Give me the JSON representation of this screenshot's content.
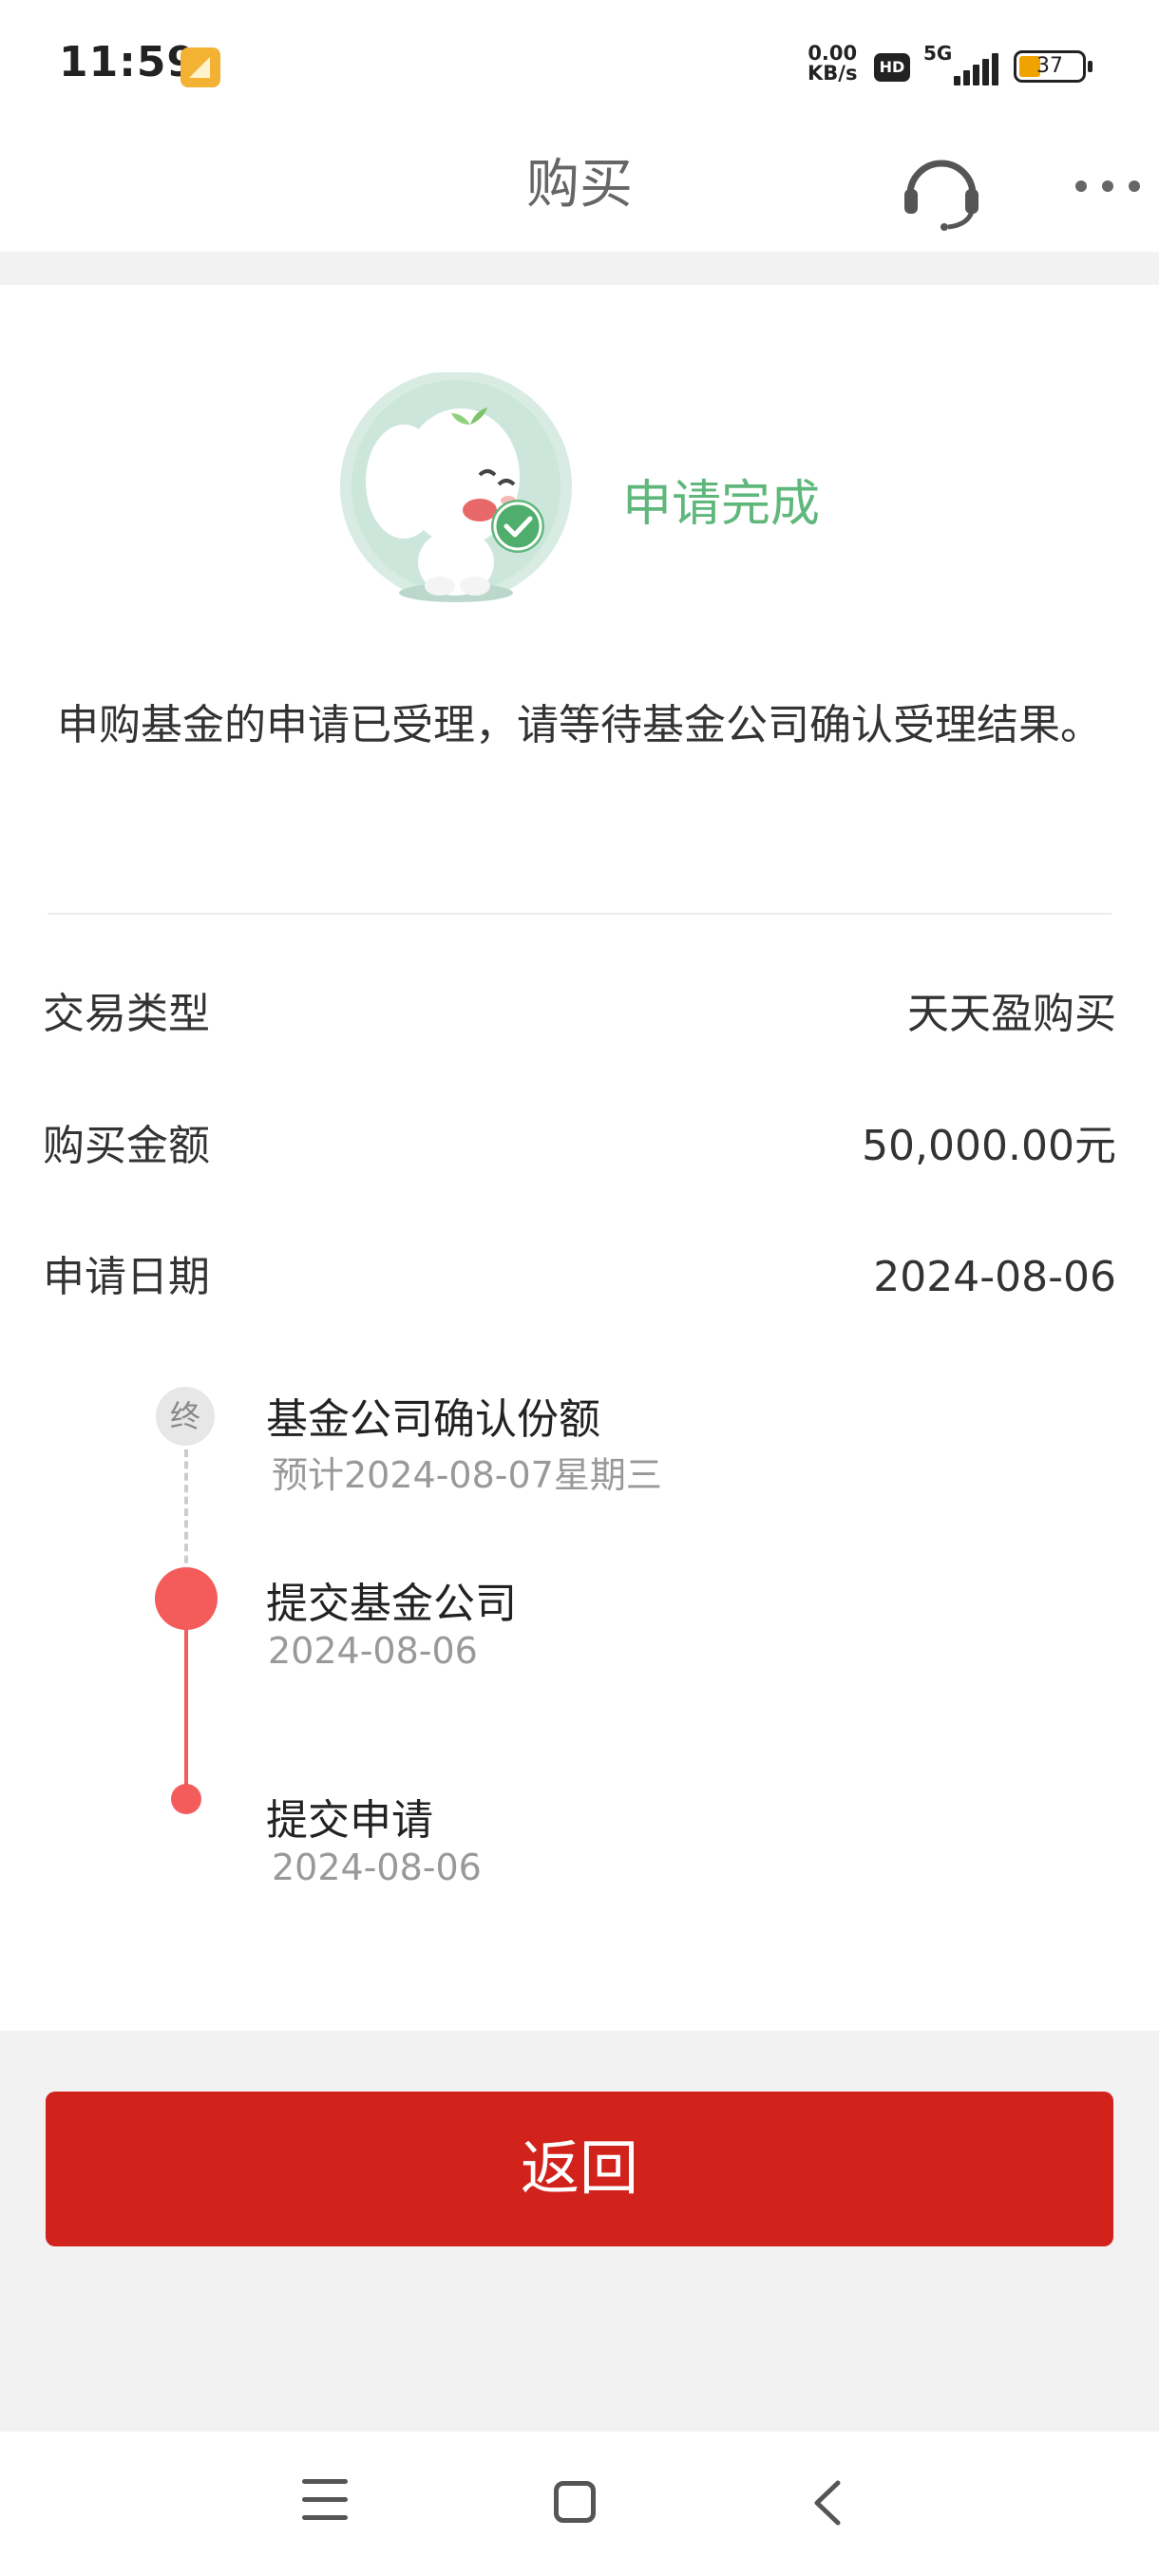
{
  "status_bar": {
    "time": "11:59",
    "net_speed_value": "0.00",
    "net_speed_unit": "KB/s",
    "hd_badge": "HD",
    "network_type": "5G",
    "battery_level": "37"
  },
  "header": {
    "title": "购买"
  },
  "result": {
    "status_text": "申请完成",
    "message": "申购基金的申请已受理，请等待基金公司确认受理结果。"
  },
  "details": [
    {
      "label": "交易类型",
      "value": "天天盈购买"
    },
    {
      "label": "购买金额",
      "value": "50,000.00元"
    },
    {
      "label": "申请日期",
      "value": "2024-08-06"
    }
  ],
  "timeline": {
    "end_marker": "终",
    "steps": [
      {
        "title": "基金公司确认份额",
        "subtitle": "预计2024-08-07星期三",
        "state": "pending"
      },
      {
        "title": "提交基金公司",
        "subtitle": "2024-08-06",
        "state": "current"
      },
      {
        "title": "提交申请",
        "subtitle": "2024-08-06",
        "state": "done"
      }
    ]
  },
  "actions": {
    "back_label": "返回"
  },
  "colors": {
    "accent_red": "#d2221c",
    "timeline_red": "#f45c5c",
    "success_green": "#5fb77b"
  },
  "icons": {
    "header_service": "headset-icon",
    "header_more": "more-icon",
    "nav_menu": "menu-icon",
    "nav_home": "home-icon",
    "nav_back": "back-icon"
  }
}
